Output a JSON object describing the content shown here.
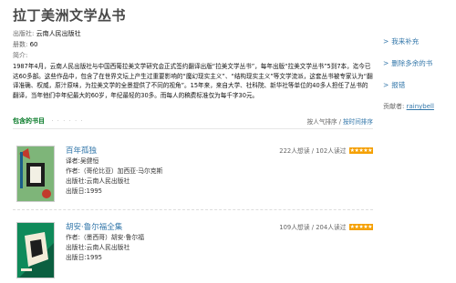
{
  "title": "拉丁美洲文学丛书",
  "meta": {
    "publisher_label": "出版社:",
    "publisher": "云南人民出版社",
    "volumes_label": "册数:",
    "volumes": "60",
    "intro_label": "简介:"
  },
  "intro": "1987年4月，云南人民出版社与中国西葡拉美文学研究会正式签约翻译出版“拉美文学丛书”，每年出版“拉美文学丛书”5到7本，迄今已达60多部。这些作品中，包含了在世界文坛上产生过重要影响的“魔幻现实主义”、“结构现实主义”等文学流派，这套丛书被专家认为“翻译准确、权威，原汁原味，为拉美文学的全景提供了不同的视角”。15年来，来自大学、社科院、新华社等单位的40多人担任了丛书的翻译，当年他们中年纪最大的60岁，年纪最轻的30多。而每人的稿费标准仅为每千字30元。",
  "section": {
    "label": "包含的书目",
    "dots": "· · · · · ·",
    "sort_popular": "按人气排序",
    "sort_sep": " / ",
    "sort_time": "按时间排序"
  },
  "books": [
    {
      "title": "百年孤独",
      "translator": "译者:吴健恒",
      "author": "作者:（哥伦比亚）加西亚·马尔克斯",
      "publisher": "出版社:云南人民出版社",
      "year": "出版日:1995",
      "stats": "222人想读 / 102人读过",
      "stars": "★★★★★"
    },
    {
      "title": "胡安·鲁尔福全集",
      "author": "作者:（墨西哥）胡安·鲁尔福",
      "publisher": "出版社:云南人民出版社",
      "year": "出版日:1995",
      "stats": "109人想读 / 204人读过",
      "stars": "★★★★★"
    }
  ],
  "side": {
    "add": "我来补充",
    "remove": "删除多余的书",
    "report": "报错",
    "contributor_label": "贡献者:",
    "contributor": "rainybell"
  },
  "colors": {
    "link": "#3377aa",
    "green": "#007722",
    "star": "#f5a000"
  }
}
